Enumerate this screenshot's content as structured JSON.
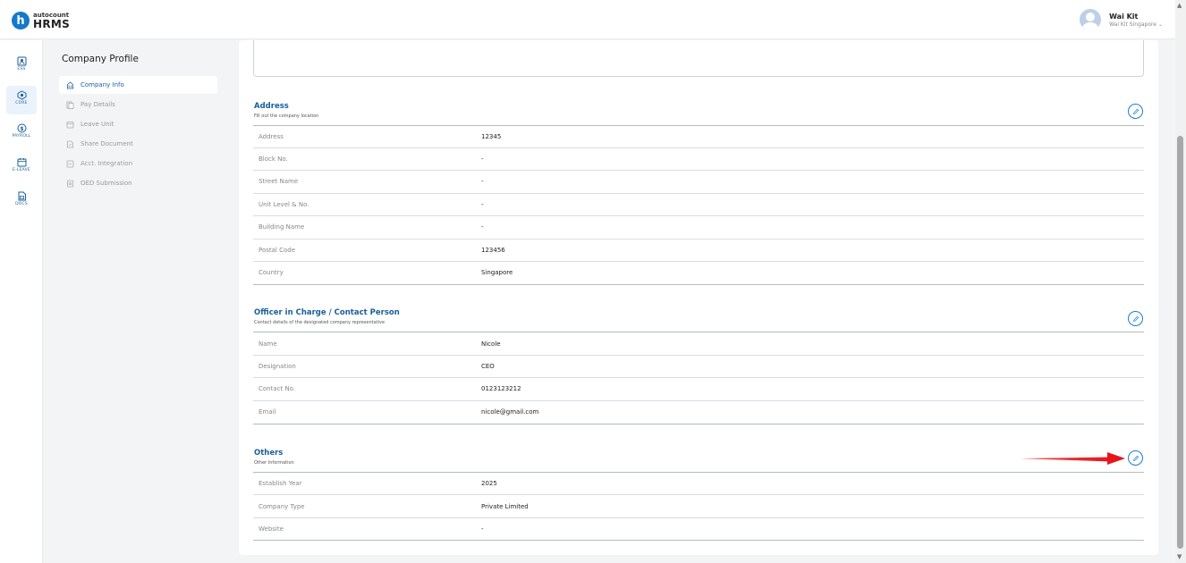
{
  "brand": {
    "small": "autocount",
    "big": "HRMS"
  },
  "user": {
    "name": "Wai Kit",
    "subtitle": "Wai Kit Singapore ⌄"
  },
  "rail": [
    {
      "label": "ESS",
      "icon": "ess-icon"
    },
    {
      "label": "CORE",
      "icon": "core-icon"
    },
    {
      "label": "PAYROLL",
      "icon": "payroll-icon"
    },
    {
      "label": "E-LEAVE",
      "icon": "calendar-icon"
    },
    {
      "label": "DOCS",
      "icon": "docs-icon"
    }
  ],
  "subnav": {
    "title": "Company Profile",
    "items": [
      {
        "label": "Company Info",
        "icon": "building-icon"
      },
      {
        "label": "Pay Details",
        "icon": "pay-details-icon"
      },
      {
        "label": "Leave Unit",
        "icon": "leave-unit-icon"
      },
      {
        "label": "Share Document",
        "icon": "share-document-icon"
      },
      {
        "label": "Acct. Integration",
        "icon": "integration-icon"
      },
      {
        "label": "OED Submission",
        "icon": "submission-icon"
      }
    ]
  },
  "address": {
    "title": "Address",
    "subtitle": "Fill out the company location",
    "rows": [
      {
        "label": "Address",
        "value": "12345"
      },
      {
        "label": "Block No.",
        "value": "-"
      },
      {
        "label": "Street Name",
        "value": "-"
      },
      {
        "label": "Unit Level & No.",
        "value": "-"
      },
      {
        "label": "Building Name",
        "value": "-"
      },
      {
        "label": "Postal Code",
        "value": "123456"
      },
      {
        "label": "Country",
        "value": "Singapore"
      }
    ]
  },
  "officer": {
    "title": "Officer in Charge / Contact Person",
    "subtitle": "Contact details of the designated company representative",
    "rows": [
      {
        "label": "Name",
        "value": "Nicole"
      },
      {
        "label": "Designation",
        "value": "CEO"
      },
      {
        "label": "Contact No.",
        "value": "0123123212"
      },
      {
        "label": "Email",
        "value": "nicole@gmail.com"
      }
    ]
  },
  "others": {
    "title": "Others",
    "subtitle": "Other Information",
    "rows": [
      {
        "label": "Establish Year",
        "value": "2025"
      },
      {
        "label": "Company Type",
        "value": "Private Limited"
      },
      {
        "label": "Website",
        "value": "-"
      }
    ]
  },
  "colors": {
    "accent": "#1a5f99",
    "annotation": "#e8141b"
  }
}
